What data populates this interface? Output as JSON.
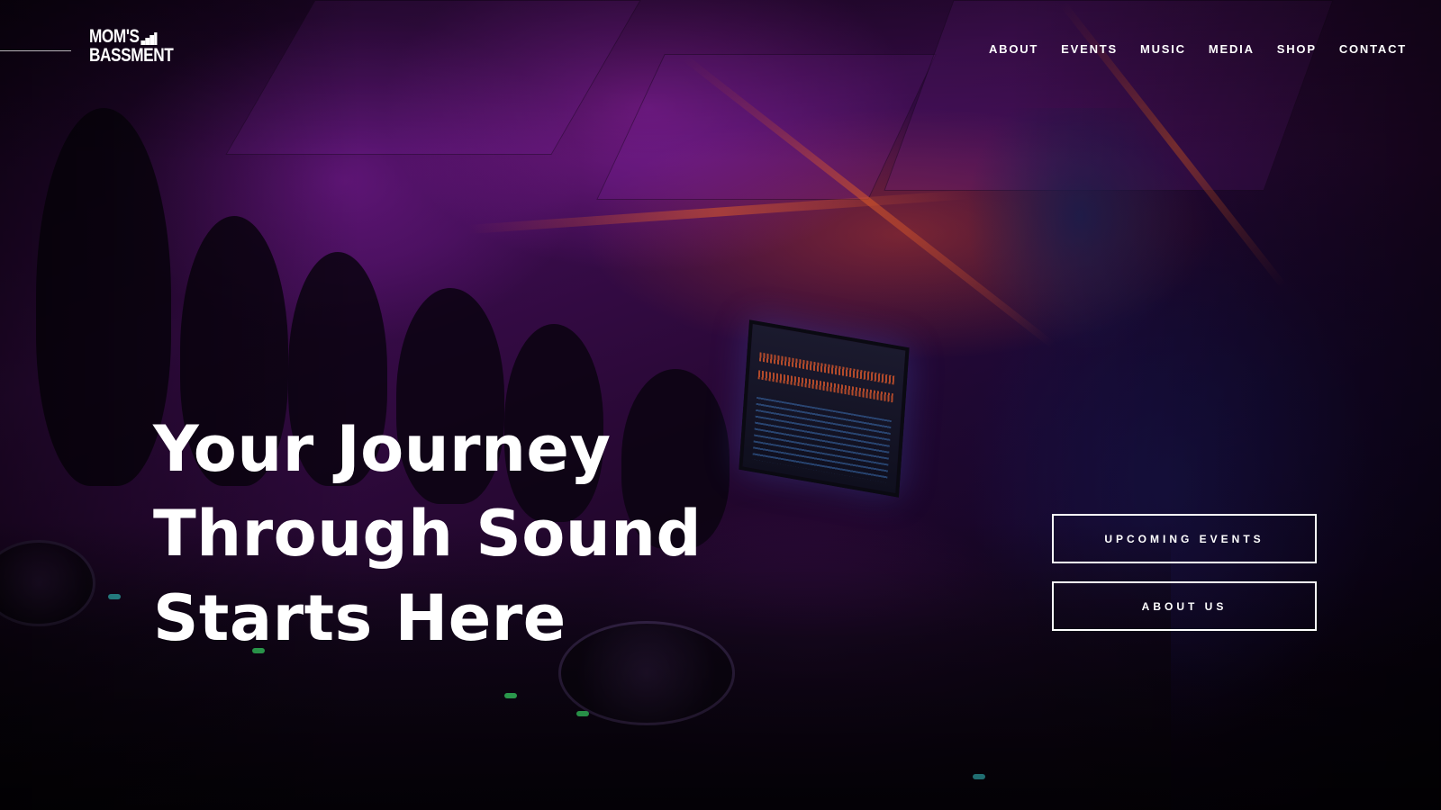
{
  "brand": {
    "logo_line1": "MOM'S",
    "logo_line2": "BASSMENT"
  },
  "nav": {
    "items": [
      {
        "label": "ABOUT"
      },
      {
        "label": "EVENTS"
      },
      {
        "label": "MUSIC"
      },
      {
        "label": "MEDIA"
      },
      {
        "label": "SHOP"
      },
      {
        "label": "CONTACT"
      }
    ]
  },
  "hero": {
    "headline_lines": [
      "Your Journey",
      "Through Sound",
      "Starts Here"
    ],
    "buttons": {
      "upcoming_events": "UPCOMING EVENTS",
      "about_us": "ABOUT US"
    },
    "background_image": "dj-performing-at-crowded-tent-party"
  },
  "colors": {
    "text": "#ffffff",
    "overlay_tint": "#3a0c4c",
    "accent_orange": "#d9572b"
  }
}
